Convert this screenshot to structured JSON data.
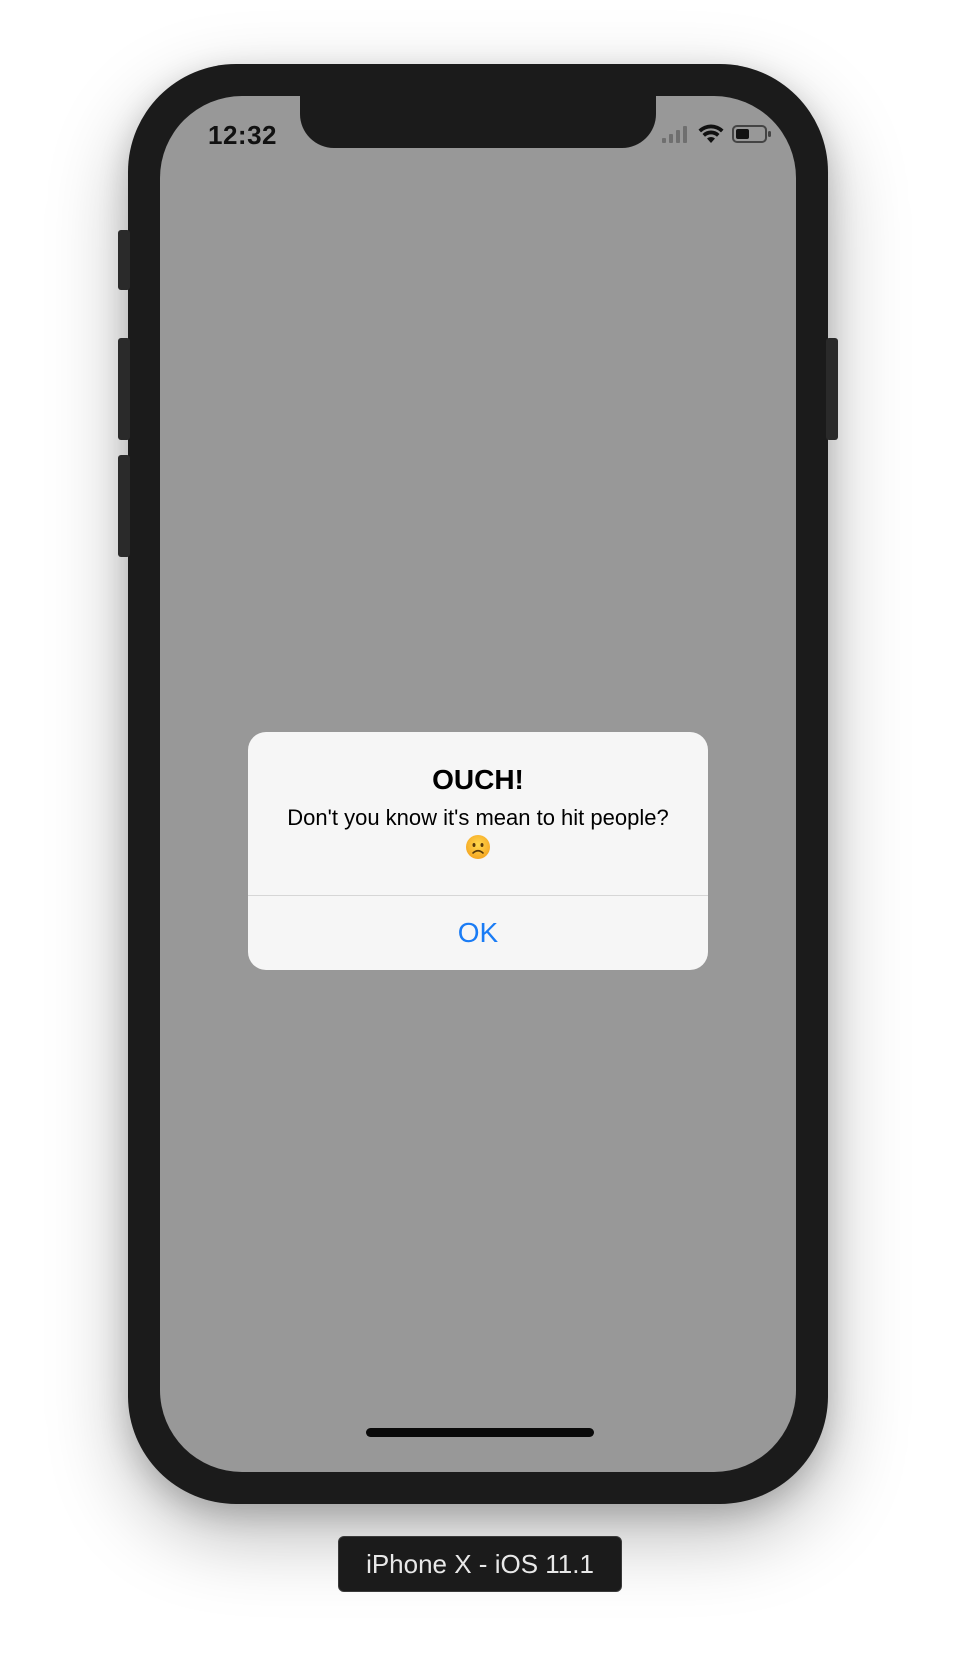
{
  "status_bar": {
    "time": "12:32",
    "icons": [
      "cellular-signal-icon",
      "wifi-icon",
      "battery-icon"
    ]
  },
  "alert": {
    "title": "OUCH!",
    "message": "Don't you know it's mean to hit people?",
    "emoji": "frowning-face-emoji",
    "ok_label": "OK"
  },
  "device_label": "iPhone X - iOS 11.1",
  "colors": {
    "screen_background": "#989898",
    "alert_background": "#f6f6f6",
    "button_tint": "#1a7cf5",
    "device_body": "#1b1b1b"
  }
}
